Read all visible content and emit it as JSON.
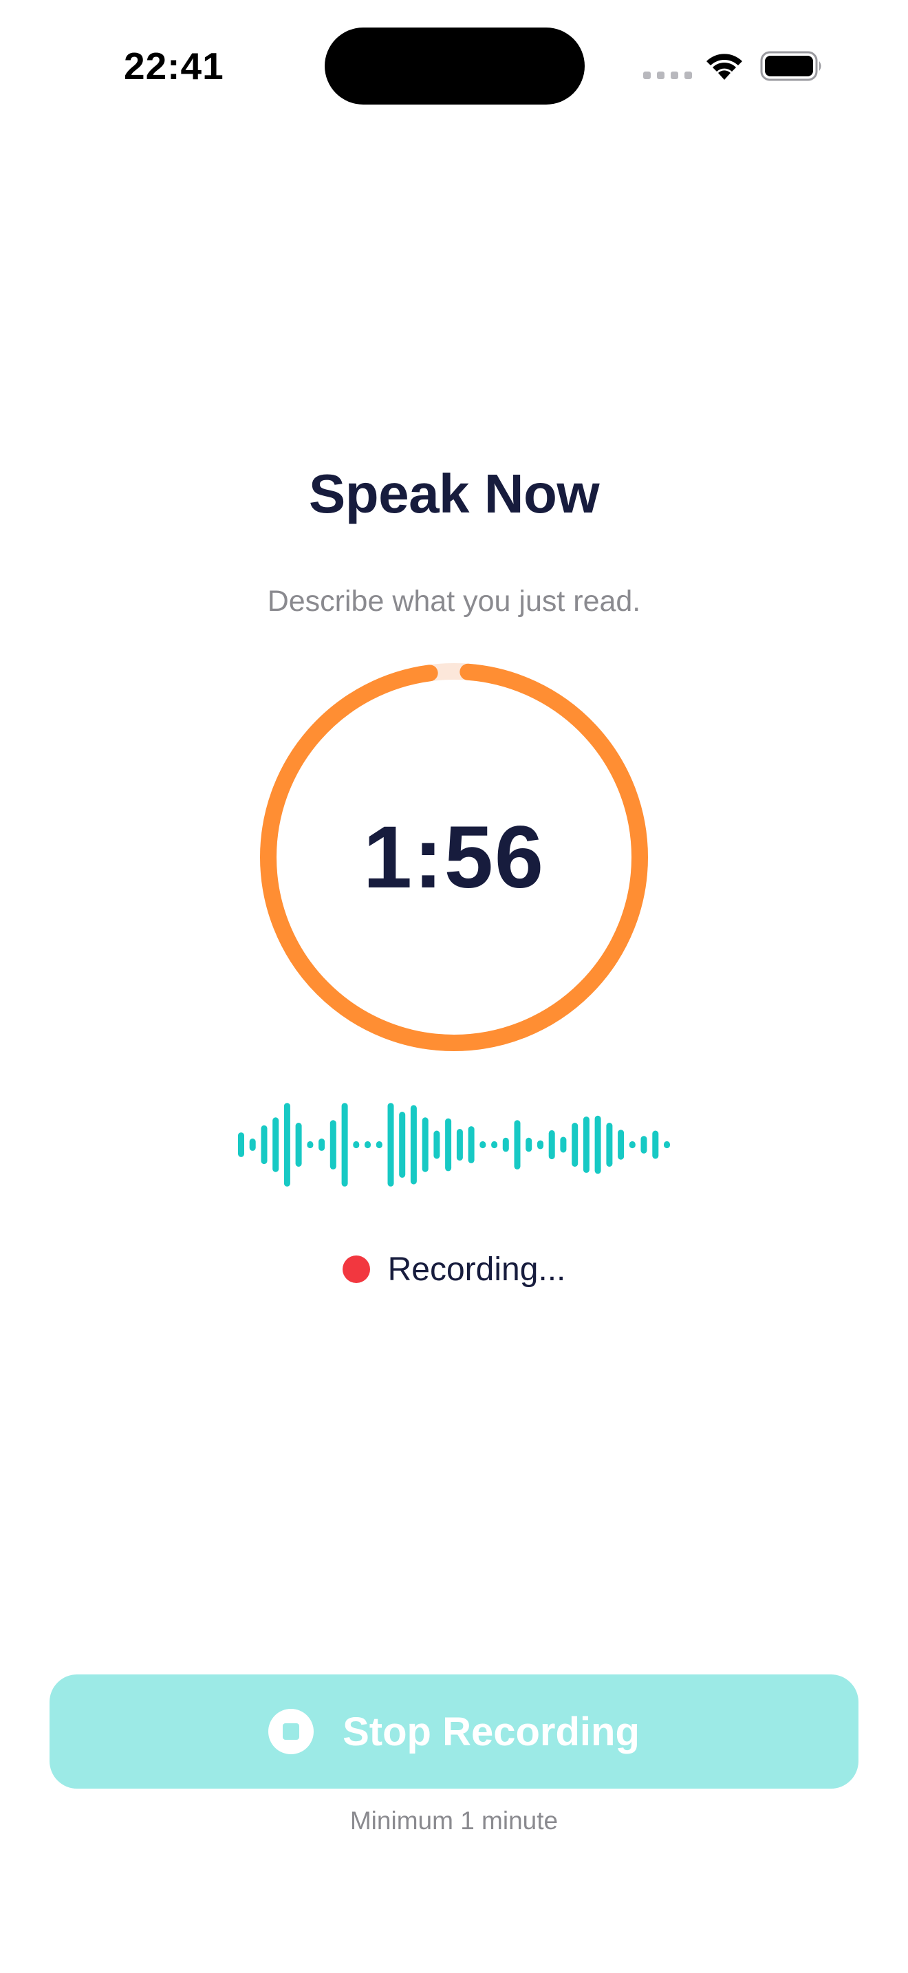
{
  "status_bar": {
    "time": "22:41",
    "icons": [
      "cellular-signal-icon",
      "wifi-icon",
      "battery-icon"
    ]
  },
  "screen": {
    "title": "Speak Now",
    "subtitle": "Describe what you just read."
  },
  "timer": {
    "display": "1:56",
    "progress_fraction": 0.967,
    "ring_color": "#FF8E33",
    "ring_track_color": "#FCE7DA"
  },
  "waveform": {
    "color": "#17C9C4",
    "levels": [
      0.28,
      0.14,
      0.44,
      0.62,
      0.95,
      0.5,
      0.08,
      0.14,
      0.56,
      0.95,
      0.08,
      0.08,
      0.08,
      0.95,
      0.75,
      0.9,
      0.62,
      0.32,
      0.6,
      0.36,
      0.42,
      0.08,
      0.08,
      0.16,
      0.56,
      0.16,
      0.1,
      0.33,
      0.18,
      0.5,
      0.64,
      0.66,
      0.5,
      0.34,
      0.08,
      0.2,
      0.32,
      0.08
    ]
  },
  "recording": {
    "label": "Recording...",
    "dot_color": "#F2373F"
  },
  "stop_button": {
    "label": "Stop Recording",
    "icon": "stop-icon",
    "background": "#9CEAE6"
  },
  "hint": "Minimum 1 minute"
}
